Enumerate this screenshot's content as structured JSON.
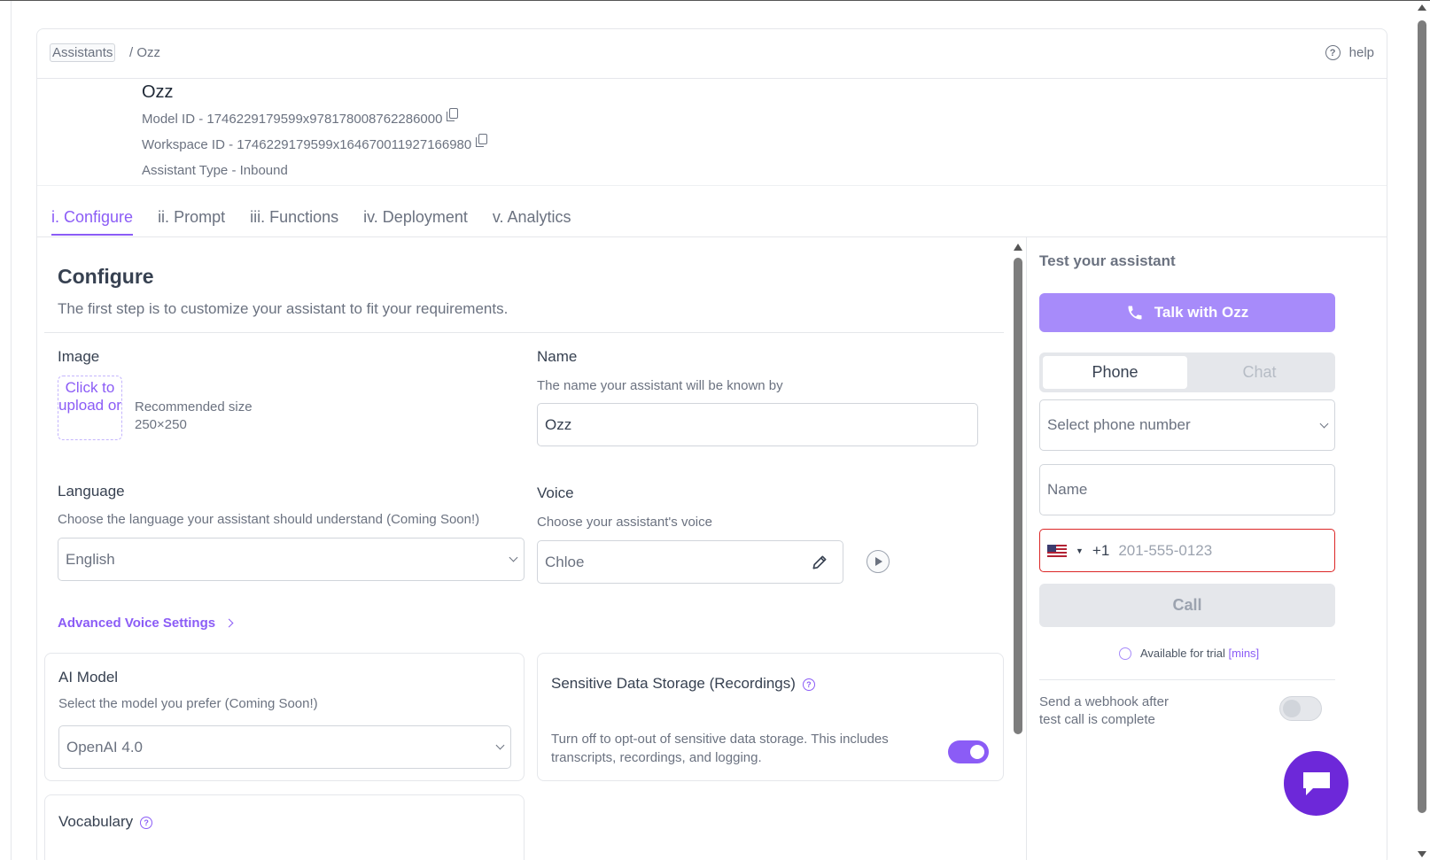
{
  "breadcrumb": {
    "root": "Assistants",
    "current": "/ Ozz"
  },
  "help": {
    "label": "help",
    "icon": "question-circle-icon"
  },
  "assistant": {
    "name": "Ozz",
    "model_id": "Model ID - 1746229179599x978178008762286000",
    "workspace_id": "Workspace ID - 1746229179599x164670011927166980",
    "type": "Assistant Type - Inbound"
  },
  "tabs": [
    {
      "label": "i. Configure",
      "active": true
    },
    {
      "label": "ii. Prompt",
      "active": false
    },
    {
      "label": "iii. Functions",
      "active": false
    },
    {
      "label": "iv. Deployment",
      "active": false
    },
    {
      "label": "v. Analytics",
      "active": false
    }
  ],
  "configure": {
    "title": "Configure",
    "subtitle": "The first step is to customize your assistant to fit your requirements.",
    "image": {
      "label": "Image",
      "upload_text": "Click to upload or",
      "rec_label": "Recommended size",
      "rec_value": "250×250"
    },
    "name": {
      "label": "Name",
      "hint": "The name your assistant will be known by",
      "value": "Ozz"
    },
    "language": {
      "label": "Language",
      "hint": "Choose the language your assistant should understand (Coming Soon!)",
      "value": "English"
    },
    "voice": {
      "label": "Voice",
      "hint": "Choose your assistant's voice",
      "value": "Chloe"
    },
    "advanced_link": "Advanced Voice Settings",
    "ai_model": {
      "label": "AI Model",
      "hint": "Select the model you prefer (Coming Soon!)",
      "value": "OpenAI 4.0"
    },
    "sensitive": {
      "label": "Sensitive Data Storage (Recordings)",
      "desc": "Turn off to opt-out of sensitive data storage. This includes transcripts, recordings, and logging.",
      "enabled": true
    },
    "vocabulary": {
      "label": "Vocabulary"
    }
  },
  "test_panel": {
    "title": "Test your assistant",
    "talk_button": "Talk with Ozz",
    "segments": [
      "Phone",
      "Chat"
    ],
    "active_segment": "Phone",
    "phone_select_placeholder": "Select phone number",
    "name_placeholder": "Name",
    "country_code": "+1",
    "phone_placeholder": "201-555-0123",
    "call_button": "Call",
    "trial_text": "Available for trial",
    "trial_mins": "[mins]",
    "webhook_text": "Send a webhook after test call is complete",
    "webhook_enabled": false
  },
  "colors": {
    "accent": "#8b5cf6",
    "accent_light": "#a78bfa",
    "fab": "#6d28d9",
    "error_border": "#dc2626"
  }
}
